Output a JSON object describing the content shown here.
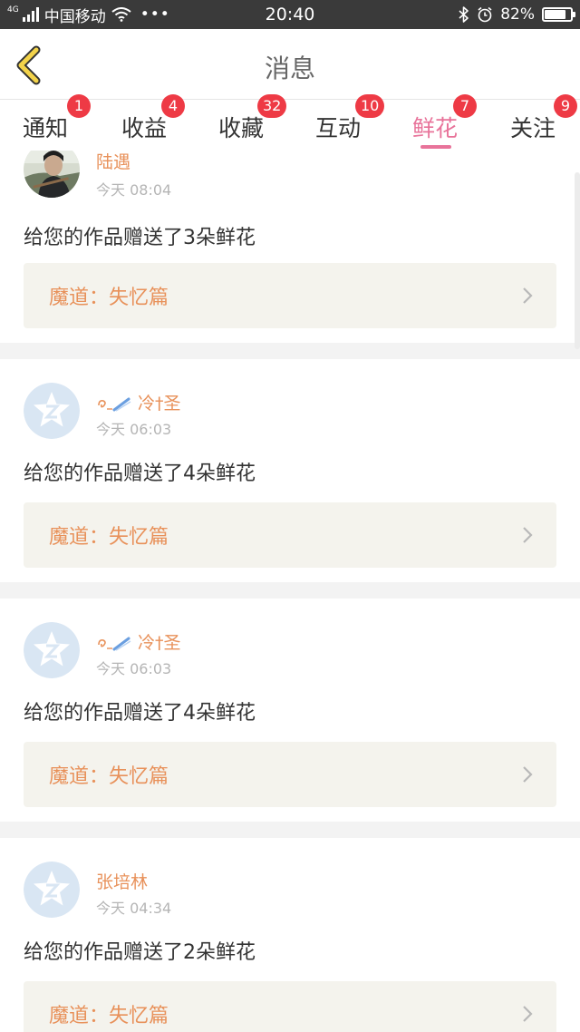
{
  "status_bar": {
    "network": "4G",
    "carrier": "中国移动",
    "time": "20:40",
    "battery": "82%",
    "battery_level": 0.82
  },
  "header": {
    "title": "消息"
  },
  "tabs": [
    {
      "label": "通知",
      "badge": "1"
    },
    {
      "label": "收益",
      "badge": "4"
    },
    {
      "label": "收藏",
      "badge": "32"
    },
    {
      "label": "互动",
      "badge": "10"
    },
    {
      "label": "鲜花",
      "badge": "7",
      "active": true
    },
    {
      "label": "关注",
      "badge": "9"
    }
  ],
  "feed": [
    {
      "user": "陆遇",
      "time": "今天 08:04",
      "message": "给您的作品赠送了3朵鲜花",
      "work": "魔道：失忆篇",
      "avatar": "photo"
    },
    {
      "user": "冷†圣",
      "time": "今天 06:03",
      "message": "给您的作品赠送了4朵鲜花",
      "work": "魔道：失忆篇",
      "avatar": "default"
    },
    {
      "user": "冷†圣",
      "time": "今天 06:03",
      "message": "给您的作品赠送了4朵鲜花",
      "work": "魔道：失忆篇",
      "avatar": "default"
    },
    {
      "user": "张培林",
      "time": "今天 04:34",
      "message": "给您的作品赠送了2朵鲜花",
      "work": "魔道：失忆篇",
      "avatar": "default"
    }
  ],
  "colors": {
    "accent": "#e8739a",
    "badge": "#ee3a45",
    "name": "#e8915a",
    "link_bg": "#f4f3ed",
    "avatar_default": "#d9e6f3"
  }
}
